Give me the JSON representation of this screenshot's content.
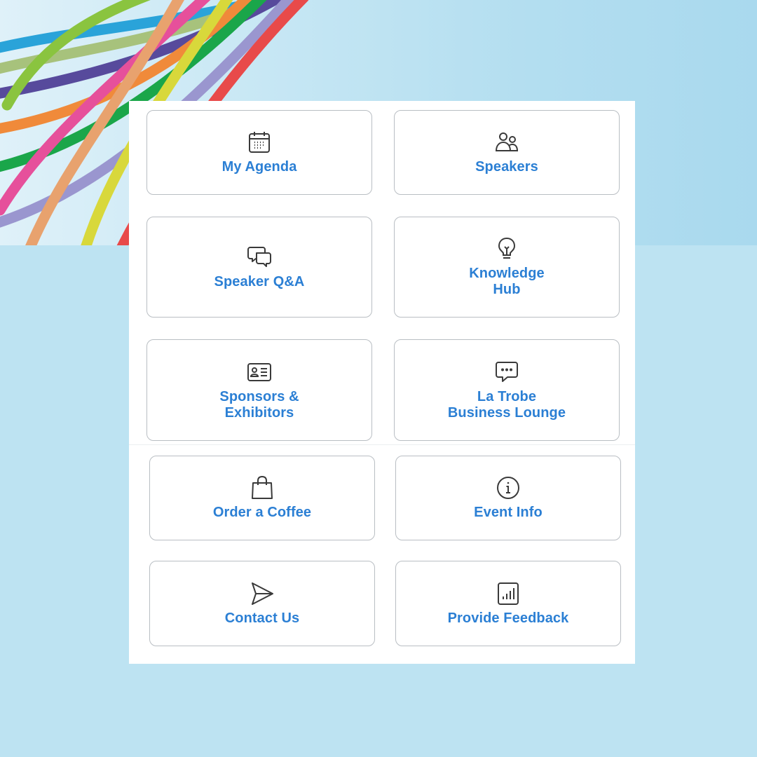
{
  "colors": {
    "label": "#2b7fd4",
    "icon": "#3a3a3a",
    "border": "#b9bec3",
    "background": "#bde3f2"
  },
  "tiles": [
    {
      "label": "My Agenda",
      "icon": "calendar-icon"
    },
    {
      "label": "Speakers",
      "icon": "people-icon"
    },
    {
      "label": "Speaker Q&A",
      "icon": "chat-bubbles-icon"
    },
    {
      "label": "Knowledge\nHub",
      "icon": "lightbulb-icon"
    },
    {
      "label": "Sponsors &\nExhibitors",
      "icon": "id-card-icon"
    },
    {
      "label": "La Trobe\nBusiness Lounge",
      "icon": "message-dots-icon"
    },
    {
      "label": "Order a Coffee",
      "icon": "shopping-bag-icon"
    },
    {
      "label": "Event Info",
      "icon": "info-icon"
    },
    {
      "label": "Contact Us",
      "icon": "send-icon"
    },
    {
      "label": "Provide Feedback",
      "icon": "bar-chart-icon"
    }
  ]
}
